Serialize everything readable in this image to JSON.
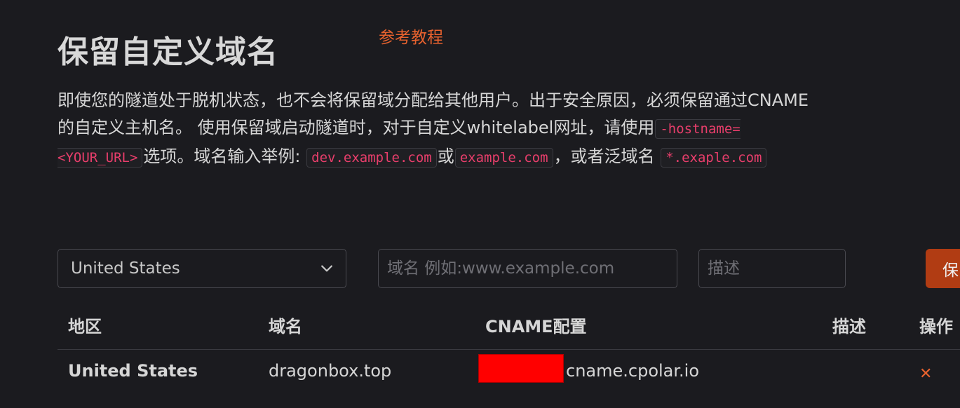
{
  "page": {
    "title": "保留自定义域名",
    "tutorial_link": "参考教程"
  },
  "description": {
    "line1": "即使您的隧道处于脱机状态，也不会将保留域分配给其他用户。出于安全原因，必须保留通过CNAME的自定义主机名。 使用保留域启动隧道时，对于自定义whitelabel网址，请使用",
    "code1": "-hostname=<YOUR_URL>",
    "part2": "选项。域名输入举例:",
    "code2": "dev.example.com",
    "part3": "或",
    "code3": "example.com",
    "part4": "，或者泛域名",
    "code4": "*.exaple.com"
  },
  "form": {
    "region_value": "United States",
    "domain_placeholder": "域名 例如:www.example.com",
    "desc_placeholder": "描述",
    "save_label": "保留"
  },
  "table": {
    "headers": [
      "地区",
      "域名",
      "CNAME配置",
      "描述",
      "操作"
    ],
    "rows": [
      {
        "region": "United States",
        "domain": "dragonbox.top",
        "cname_suffix": "cname.cpolar.io",
        "description": "",
        "action_icon": "close-icon"
      }
    ]
  },
  "colors": {
    "background": "#1b1b1f",
    "accent": "#e8622e",
    "button": "#b13c13",
    "code": "#e83e6b",
    "redaction": "#ff0000"
  }
}
